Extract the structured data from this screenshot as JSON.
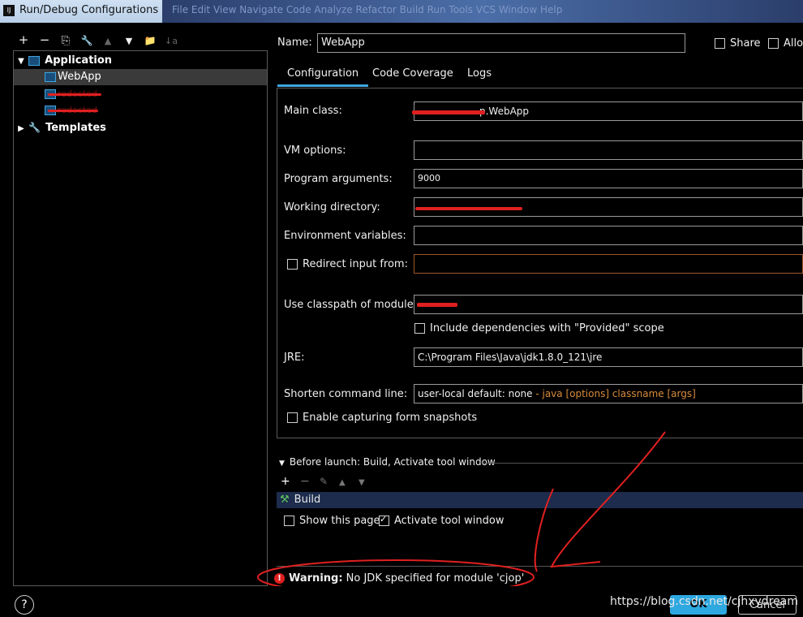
{
  "window": {
    "title": "Run/Debug Configurations",
    "behind_menu": "File  Edit  View  Navigate  Code  Analyze  Refactor  Build  Run  Tools  VCS  Window  Help"
  },
  "toolbar_left": {
    "add": "+",
    "remove": "−",
    "copy": "⎘",
    "edit": "🔧",
    "up": "▲",
    "down": "▼",
    "folder": "📁",
    "sort": "↓a"
  },
  "tree": {
    "application": "Application",
    "items": [
      "WebApp",
      "redacted",
      "redacted"
    ],
    "templates": "Templates"
  },
  "header": {
    "name_label": "Name:",
    "name_value": "WebApp",
    "share_label": "Share",
    "allow_label": "Allo"
  },
  "tabs": [
    "Configuration",
    "Code Coverage",
    "Logs"
  ],
  "form": {
    "main_class_label": "Main class:",
    "main_class_value": "p.WebApp",
    "vm_options_label": "VM options:",
    "vm_options_value": "",
    "program_args_label": "Program arguments:",
    "program_args_value": "9000",
    "working_dir_label": "Working directory:",
    "working_dir_value": "",
    "env_vars_label": "Environment variables:",
    "env_vars_value": "",
    "redirect_label": "Redirect input from:",
    "classpath_label": "Use classpath of module:",
    "classpath_value": "",
    "include_deps_label": "Include dependencies with \"Provided\" scope",
    "jre_label": "JRE:",
    "jre_value": "C:\\Program Files\\Java\\jdk1.8.0_121\\jre",
    "shorten_label": "Shorten command line:",
    "shorten_value": "user-local default: none",
    "shorten_hint": " - java [options] classname [args]",
    "snapshots_label": "Enable capturing form snapshots"
  },
  "before_launch": {
    "title": "Before launch: Build, Activate tool window",
    "task": "Build",
    "show_page_label": "Show this page",
    "activate_label": "Activate tool window"
  },
  "warning": {
    "prefix": "Warning:",
    "text": " No JDK specified for module 'cjop'"
  },
  "buttons": {
    "ok": "OK",
    "cancel": "Cancel",
    "help": "?"
  },
  "watermark": "https://blog.csdn.net/cjhxydream",
  "colors": {
    "accent": "#3fa6e0",
    "warning": "#e02020",
    "selection": "#1d2c4d",
    "shorten_hint": "#d98b3a"
  }
}
